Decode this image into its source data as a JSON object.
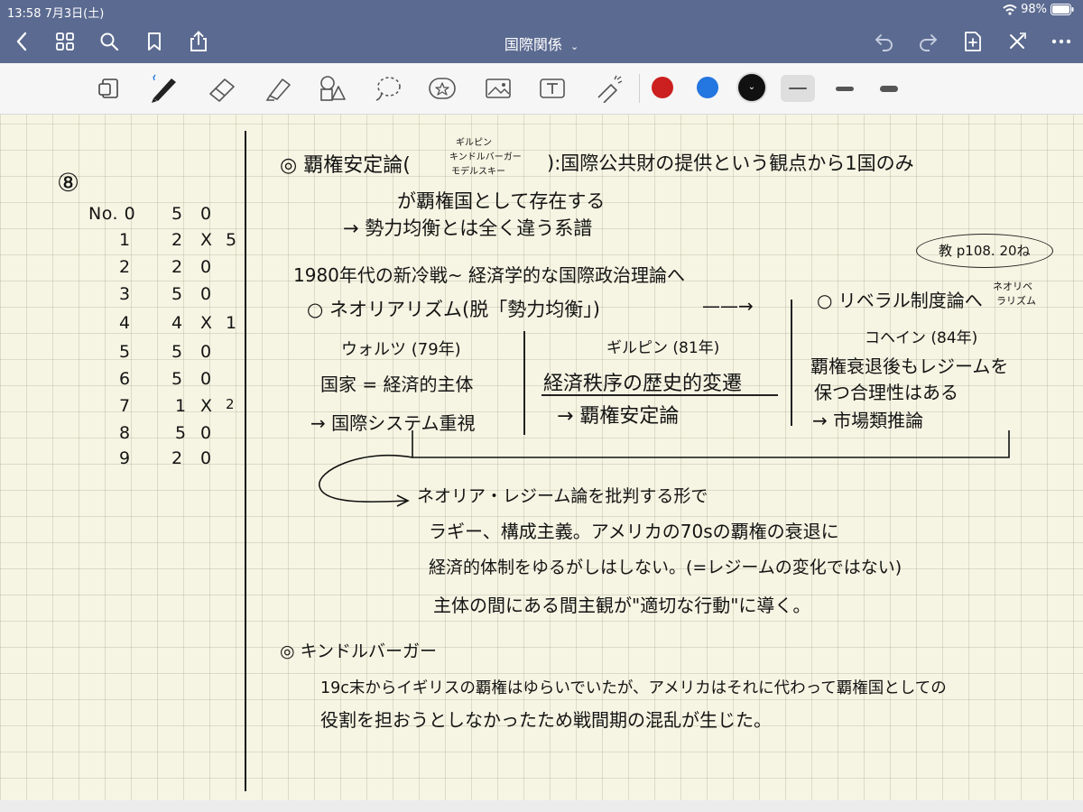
{
  "status_bar": {
    "time_date": "13:58   7月3日(土)",
    "battery": "98%"
  },
  "nav": {
    "title": "国際関係"
  },
  "colors": {
    "nav_bg": "#5b6a90",
    "red": "#cc1f1f",
    "blue": "#2476e0",
    "black": "#111111"
  },
  "icons": [
    "back-icon",
    "grid-icon",
    "search-icon",
    "bookmark-icon",
    "share-icon",
    "undo-icon",
    "redo-icon",
    "add-page-icon",
    "close-x-icon",
    "more-icon",
    "lasso-tablet-icon",
    "pen-icon",
    "eraser-icon",
    "highlighter-icon",
    "shapes-icon",
    "lasso-icon",
    "sticker-icon",
    "image-icon",
    "text-icon",
    "laser-pointer-icon"
  ],
  "notes": {
    "circled_number": "⑧",
    "table_rows": [
      {
        "no": "No. 0",
        "a": "5",
        "b": "0",
        "c": ""
      },
      {
        "no": "1",
        "a": "2",
        "b": "X",
        "c": "5"
      },
      {
        "no": "2",
        "a": "2",
        "b": "0",
        "c": ""
      },
      {
        "no": "3",
        "a": "5",
        "b": "0",
        "c": ""
      },
      {
        "no": "4",
        "a": "4",
        "b": "X",
        "c": "1"
      },
      {
        "no": "5",
        "a": "5",
        "b": "0",
        "c": ""
      },
      {
        "no": "6",
        "a": "5",
        "b": "0",
        "c": ""
      },
      {
        "no": "7",
        "a": "1",
        "b": "X",
        "c": "2"
      },
      {
        "no": "8",
        "a": "5",
        "b": "0",
        "c": ""
      },
      {
        "no": "9",
        "a": "2",
        "b": "0",
        "c": ""
      }
    ],
    "s1_head": "◎ 覇権安定論(",
    "s1_names": [
      "ギルピン",
      "キンドルバーガー",
      "モデルスキー"
    ],
    "s1_rest": "):国際公共財の提供という観点から1国のみ",
    "s1_l2": "が覇権国として存在する",
    "s1_l3": "→ 勢力均衡とは全く違う系譜",
    "textbook_ref": "教 p108. 20ね",
    "l_1980": "1980年代の新冷戦~  経済学的な国際政治理論へ",
    "neorealism": "○ ネオリアリズム(脱「勢力均衡」)",
    "arrow_right": "——→",
    "liberal": "○ リベラル制度論へ",
    "neoliberal_note": [
      "ネオリベ",
      "ラリズム"
    ],
    "waltz_head": "ウォルツ (79年)",
    "waltz_l1": "国家 = 経済的主体",
    "waltz_l2": "→ 国際システム重視",
    "gilpin_head": "ギルピン (81年)",
    "gilpin_l1": "経済秩序の歴史的変遷",
    "gilpin_l2": "→ 覇権安定論",
    "keohane_head": "コヘイン (84年)",
    "keohane_l1": "覇権衰退後もレジームを",
    "keohane_l2": "保つ合理性はある",
    "keohane_l3": "→ 市場類推論",
    "critique_l1": "ネオリア・レジーム論を批判する形で",
    "critique_l2": "ラギー、構成主義。アメリカの70sの覇権の衰退に",
    "critique_l3": "経済的体制をゆるがしはしない。(=レジームの変化ではない)",
    "critique_l4": "主体の間にある間主観が\"適切な行動\"に導く。",
    "kindle_head": "◎ キンドルバーガー",
    "kindle_l1": "19c末からイギリスの覇権はゆらいでいたが、アメリカはそれに代わって覇権国としての",
    "kindle_l2": "役割を担おうとしなかったため戦間期の混乱が生じた。"
  }
}
